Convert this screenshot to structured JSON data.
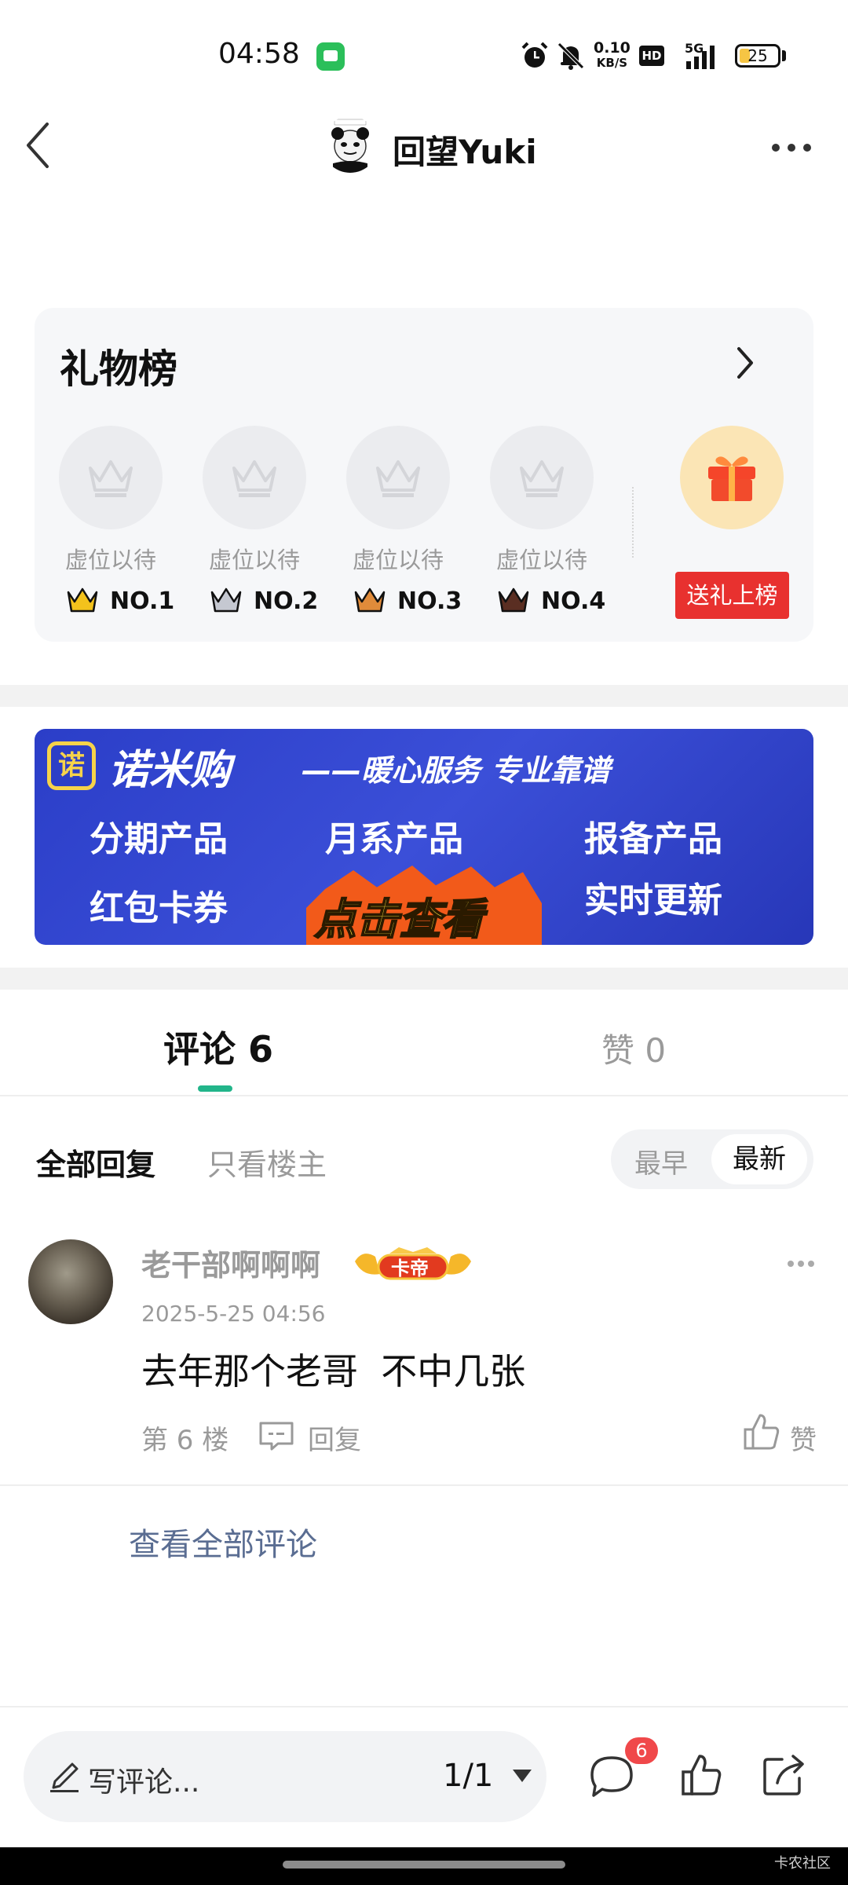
{
  "status_bar": {
    "time": "04:58",
    "net_speed_value": "0.10",
    "net_speed_unit": "KB/S",
    "hd": "HD",
    "network": "5G",
    "battery": "25",
    "icons": [
      "message-app-icon",
      "alarm-icon",
      "mute-bell-icon",
      "signal-icon",
      "battery-icon"
    ]
  },
  "header": {
    "title": "回望Yuki",
    "back_icon": "chevron-left-icon",
    "more_icon": "more-horizontal-icon"
  },
  "gift_board": {
    "title": "礼物榜",
    "slots": [
      {
        "label": "虚位以待",
        "rank": "NO.1",
        "crown_color": "#f3c21c"
      },
      {
        "label": "虚位以待",
        "rank": "NO.2",
        "crown_color": "#c5c8d1"
      },
      {
        "label": "虚位以待",
        "rank": "NO.3",
        "crown_color": "#e08b3a"
      },
      {
        "label": "虚位以待",
        "rank": "NO.4",
        "crown_color": "#5a2e22"
      }
    ],
    "send_button": "送礼上榜",
    "gift_icon": "gift-box-icon"
  },
  "banner": {
    "logo": "诺",
    "title": "诺米购",
    "slogan": "——暖心服务 专业靠谱",
    "items": [
      "分期产品",
      "月系产品",
      "报备产品",
      "红包卡券",
      "实时更新"
    ],
    "cta": "点击查看"
  },
  "tabs": {
    "comments": "评论 6",
    "likes": "赞 0"
  },
  "filters": {
    "all": "全部回复",
    "op_only": "只看楼主",
    "sort_earliest": "最早",
    "sort_latest": "最新",
    "selected_sort": "最新"
  },
  "comment": {
    "author": "老干部啊啊啊",
    "badge": "卡帝",
    "time": "2025-5-25 04:56",
    "text": "去年那个老哥  不中几张",
    "floor": "第 6 楼",
    "reply": "回复",
    "like": "赞"
  },
  "view_all": "查看全部评论",
  "bottom_bar": {
    "placeholder": "写评论...",
    "page": "1/1",
    "comment_count": "6"
  },
  "watermark": "卡农社区",
  "colors": {
    "accent_green": "#22b58a",
    "send_red": "#e8312f",
    "banner_blue": "#3345cf",
    "link_blue": "#5a6d92"
  }
}
